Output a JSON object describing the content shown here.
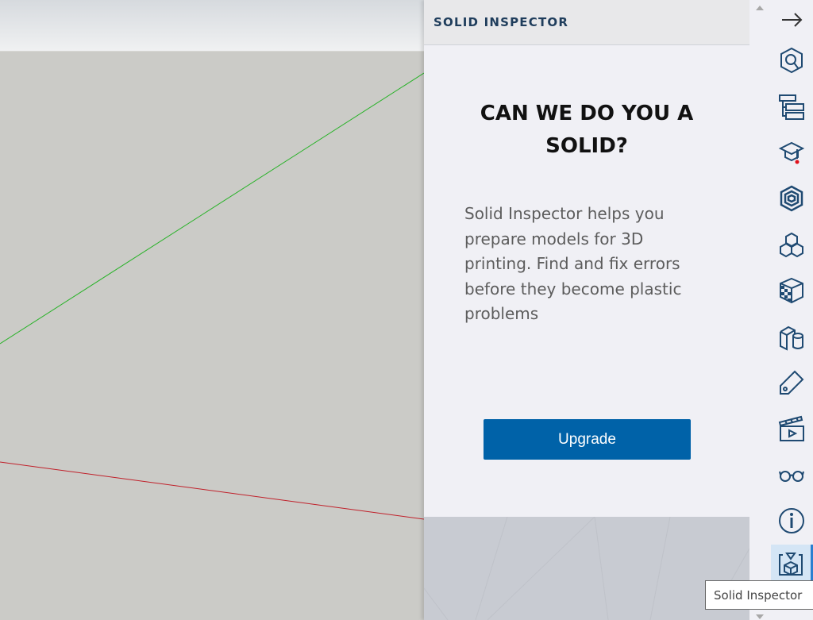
{
  "viewport": {
    "axis_colors": {
      "green": "#27b227",
      "red": "#c0202a"
    }
  },
  "panel": {
    "title": "SOLID INSPECTOR",
    "heading_line1": "CAN WE DO YOU A",
    "heading_line2": "SOLID?",
    "description": "Solid Inspector helps you prepare models for 3D printing. Find and fix errors before they become plastic problems",
    "upgrade_label": "Upgrade",
    "accent_color": "#0062a8"
  },
  "rail": {
    "items": [
      {
        "name": "collapse-panel",
        "icon": "arrow-right-icon"
      },
      {
        "name": "entity-info",
        "icon": "cube-search-icon"
      },
      {
        "name": "outliner",
        "icon": "outliner-icon"
      },
      {
        "name": "instructor",
        "icon": "graduation-cap-icon"
      },
      {
        "name": "components",
        "icon": "component-icon"
      },
      {
        "name": "materials-tags",
        "icon": "cubes-icon"
      },
      {
        "name": "materials",
        "icon": "material-cube-icon"
      },
      {
        "name": "styles",
        "icon": "box-cylinder-icon"
      },
      {
        "name": "tags",
        "icon": "tag-icon"
      },
      {
        "name": "scenes",
        "icon": "clapperboard-icon"
      },
      {
        "name": "display",
        "icon": "glasses-icon"
      },
      {
        "name": "info",
        "icon": "info-icon"
      },
      {
        "name": "solid-inspector",
        "icon": "solid-inspector-icon",
        "active": true
      }
    ]
  },
  "tooltip": {
    "text": "Solid Inspector"
  }
}
